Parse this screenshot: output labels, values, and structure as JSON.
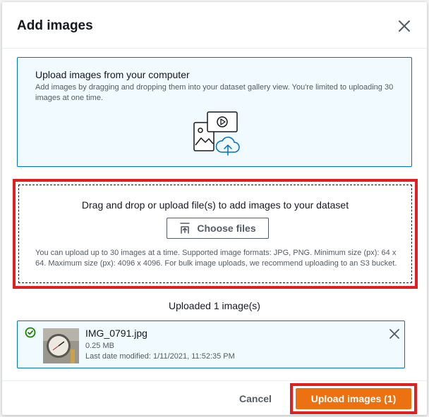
{
  "modal": {
    "title": "Add images",
    "close_icon": "close-icon"
  },
  "info": {
    "title": "Upload images from your computer",
    "description": "Add images by dragging and dropping them into your dataset gallery view. You're limited to uploading 30 images at one time.",
    "illustration_icon": "image-upload-illustration"
  },
  "dropzone": {
    "title": "Drag and drop or upload file(s) to add images to your dataset",
    "choose_files_label": "Choose files",
    "choose_files_icon": "upload-icon",
    "note": "You can upload up to 30 images at a time. Supported image formats: JPG, PNG. Minimum size (px): 64 x 64. Maximum size (px): 4096 x 4096. For bulk image uploads, we recommend uploading to an S3 bucket."
  },
  "uploaded": {
    "count_label": "Uploaded 1 image(s)",
    "files": [
      {
        "status_icon": "success-check-icon",
        "name": "IMG_0791.jpg",
        "size": "0.25 MB",
        "modified": "Last date modified: 1/11/2021, 11:52:35 PM"
      }
    ]
  },
  "footer": {
    "cancel_label": "Cancel",
    "upload_label": "Upload images (1)"
  },
  "colors": {
    "primary": "#ec7211",
    "info_border": "#0073bb",
    "info_bg": "#f1faff",
    "highlight": "#e02020",
    "success": "#1d8102"
  }
}
